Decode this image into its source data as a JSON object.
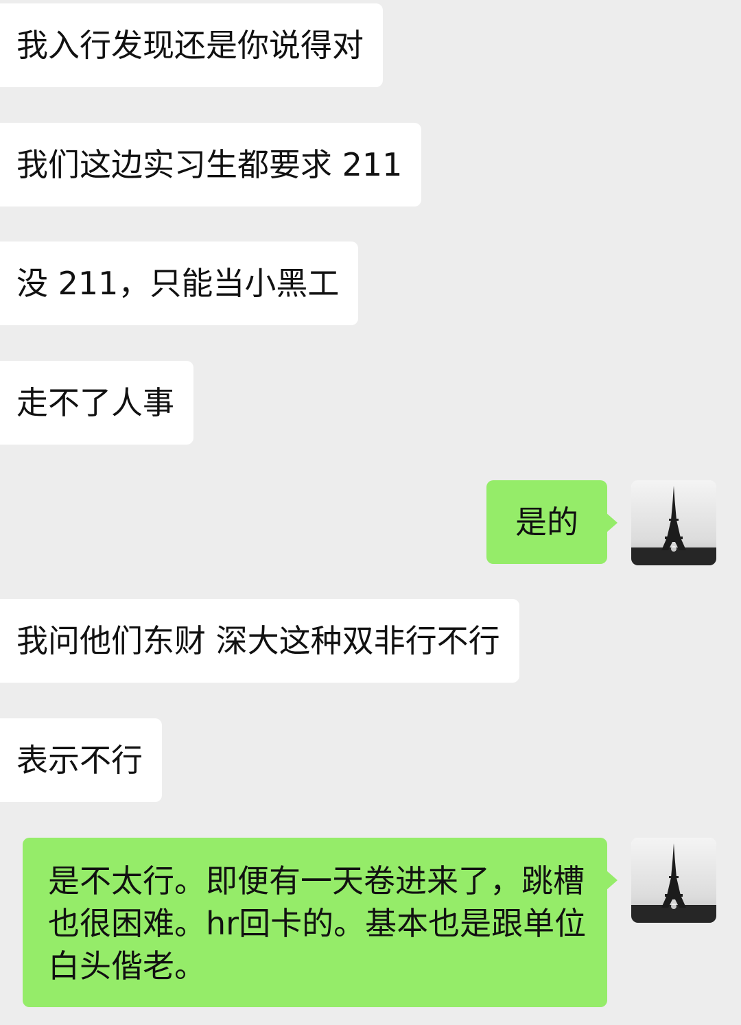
{
  "messages": [
    {
      "side": "in",
      "text": "我入行发现还是你说得对"
    },
    {
      "side": "in",
      "text": "我们这边实习生都要求 211"
    },
    {
      "side": "in",
      "text": "没 211，只能当小黑工"
    },
    {
      "side": "in",
      "text": "走不了人事"
    },
    {
      "side": "out",
      "text": "是的",
      "avatar": "eiffel-tower-avatar"
    },
    {
      "side": "in",
      "text": "我问他们东财 深大这种双非行不行"
    },
    {
      "side": "in",
      "text": "表示不行"
    },
    {
      "side": "out",
      "text": "是不太行。即便有一天卷进来了，跳槽也很困难。hr回卡的。基本也是跟单位白头偕老。",
      "avatar": "eiffel-tower-avatar"
    }
  ],
  "colors": {
    "background": "#ededed",
    "incoming_bubble": "#ffffff",
    "outgoing_bubble": "#95ec69",
    "text": "#111111"
  }
}
